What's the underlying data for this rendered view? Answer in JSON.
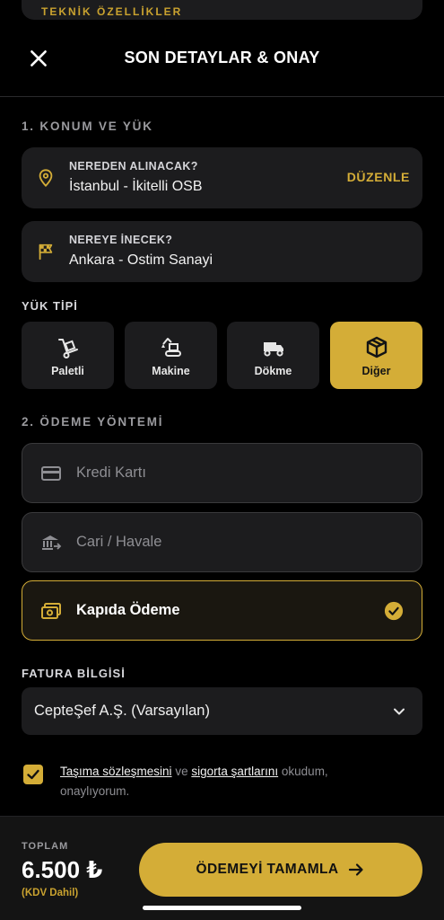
{
  "top_peek": {
    "label": "TEKNİK ÖZELLİKLER"
  },
  "header": {
    "title": "SON DETAYLAR & ONAY",
    "close_icon": "close-icon"
  },
  "section1": {
    "title": "1. KONUM VE YÜK",
    "pickup": {
      "label": "NEREDEN ALINACAK?",
      "value": "İstanbul - İkitelli OSB",
      "edit_label": "DÜZENLE",
      "icon": "location-pin-icon"
    },
    "dropoff": {
      "label": "NEREYE İNECEK?",
      "value": "Ankara - Ostim Sanayi",
      "icon": "checkered-flag-icon"
    }
  },
  "load_type": {
    "title": "YÜK TİPİ",
    "options": [
      {
        "label": "Paletli",
        "icon": "hand-truck-icon",
        "selected": false
      },
      {
        "label": "Makine",
        "icon": "excavator-icon",
        "selected": false
      },
      {
        "label": "Dökme",
        "icon": "dump-truck-icon",
        "selected": false
      },
      {
        "label": "Diğer",
        "icon": "box-icon",
        "selected": true
      }
    ]
  },
  "section2": {
    "title": "2. ÖDEME YÖNTEMİ",
    "methods": [
      {
        "label": "Kredi Kartı",
        "icon": "credit-card-icon",
        "selected": false
      },
      {
        "label": "Cari / Havale",
        "icon": "bank-transfer-icon",
        "selected": false
      },
      {
        "label": "Kapıda Ödeme",
        "icon": "cash-icon",
        "selected": true
      }
    ]
  },
  "invoice": {
    "title": "FATURA BİLGİSİ",
    "selected": "CepteŞef A.Ş. (Varsayılan)"
  },
  "agreement": {
    "checked": true,
    "link1": "Taşıma sözleşmesini",
    "connector": "ve",
    "link2": "sigorta şartlarını",
    "rest": "okudum, onaylıyorum."
  },
  "footer": {
    "total_label": "TOPLAM",
    "total_amount": "6.500 ₺",
    "vat_note": "(KDV Dahil)",
    "cta_label": "ÖDEMEYİ TAMAMLA"
  },
  "colors": {
    "accent": "#d4ad37",
    "background": "#000000",
    "card": "#1c1c1e"
  }
}
